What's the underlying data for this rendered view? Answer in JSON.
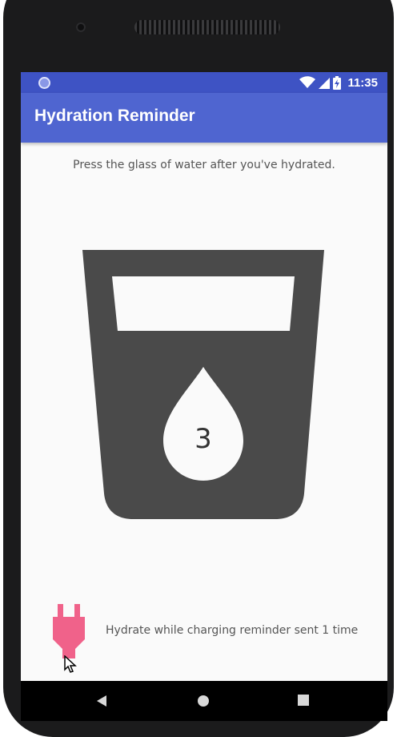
{
  "status_bar": {
    "time": "11:35",
    "icons": [
      "notification-dot-icon",
      "wifi-icon",
      "cell-signal-icon",
      "battery-charging-icon"
    ]
  },
  "app_bar": {
    "title": "Hydration Reminder"
  },
  "main": {
    "instructions": "Press the glass of water after you've hydrated.",
    "water_count": "3",
    "glass_icon": "water-glass-icon",
    "drop_icon": "water-drop-icon"
  },
  "charging": {
    "icon": "power-plug-icon",
    "reminder_text": "Hydrate while charging reminder sent 1 time"
  },
  "nav_bar": {
    "buttons": [
      "back-icon",
      "home-icon",
      "recents-icon"
    ]
  },
  "colors": {
    "status_bar": "#3e53c4",
    "app_bar": "#4f65d0",
    "glass": "#4a4a4a",
    "plug": "#f0628a",
    "background": "#fafafa"
  }
}
